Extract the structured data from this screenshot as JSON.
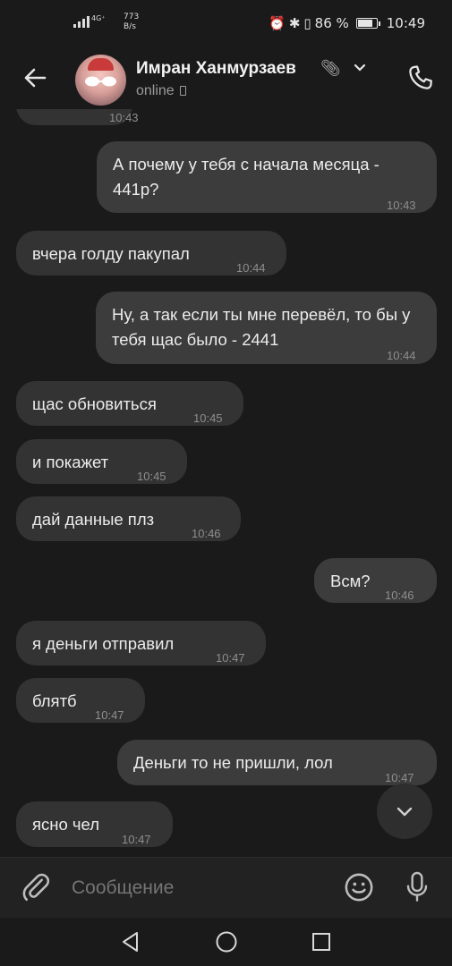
{
  "status_bar": {
    "network_type": "4G⁺",
    "network_speed_value": "773",
    "network_speed_unit": "B/s",
    "battery_percent": "86 %",
    "battery_level": 0.86,
    "time": "10:49",
    "icons": [
      "signal-icon",
      "alarm-icon",
      "bluetooth-icon",
      "vibrate-icon",
      "battery-icon"
    ]
  },
  "header": {
    "contact_name": "Имран Ханмурзаев",
    "status": "online",
    "icons": [
      "back-arrow-icon",
      "paperclip-icon",
      "chevron-down-icon",
      "phone-icon",
      "mobile-device-icon"
    ]
  },
  "messages": [
    {
      "side": "in",
      "text": "",
      "time": "10:43"
    },
    {
      "side": "out",
      "text": "А почему у тебя с начала месяца - 441р?",
      "time": "10:43"
    },
    {
      "side": "in",
      "text": "вчера голду пакупал",
      "time": "10:44"
    },
    {
      "side": "out",
      "text": "Ну, а так если ты мне перевёл, то бы у тебя щас было - 2441",
      "time": "10:44"
    },
    {
      "side": "in",
      "text": "щас обновиться",
      "time": "10:45"
    },
    {
      "side": "in",
      "text": "и покажет",
      "time": "10:45"
    },
    {
      "side": "in",
      "text": "дай данные плз",
      "time": "10:46"
    },
    {
      "side": "out",
      "text": "Всм?",
      "time": "10:46"
    },
    {
      "side": "in",
      "text": "я деньги отправил",
      "time": "10:47"
    },
    {
      "side": "in",
      "text": "блятб",
      "time": "10:47"
    },
    {
      "side": "out",
      "text": "Деньги то не пришли, лол",
      "time": "10:47"
    },
    {
      "side": "in",
      "text": "ясно чел",
      "time": "10:47"
    }
  ],
  "composer": {
    "placeholder": "Сообщение",
    "icons": [
      "paperclip-icon",
      "emoji-icon",
      "microphone-icon",
      "chevron-down-icon"
    ]
  },
  "colors": {
    "background": "#1a1a1a",
    "incoming_bubble": "#333333",
    "outgoing_bubble": "#3c3c3c",
    "text": "#ececec",
    "timestamp": "#8e8e8e"
  }
}
